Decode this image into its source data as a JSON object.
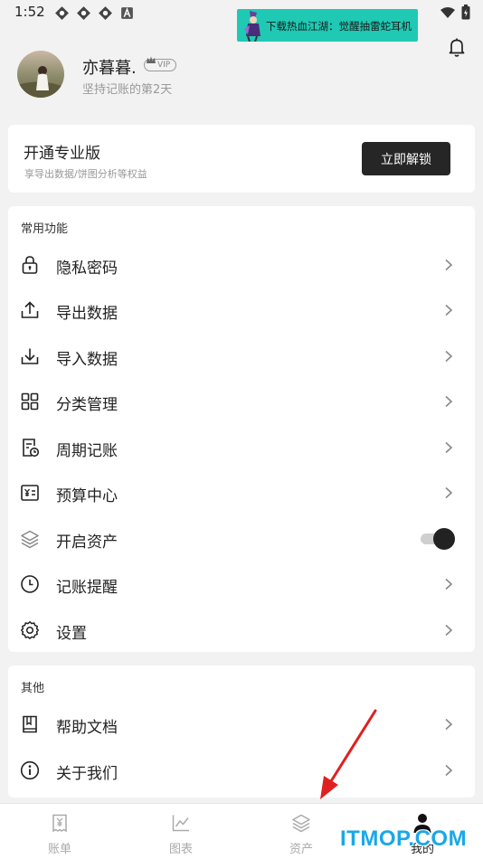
{
  "status_bar": {
    "time": "1:52"
  },
  "ad": {
    "text": "下载热血江湖：觉醒抽雷蛇耳机"
  },
  "profile": {
    "name": "亦暮暮.",
    "badge": "VIP",
    "subtitle": "坚持记账的第2天"
  },
  "pro_card": {
    "title": "开通专业版",
    "subtitle": "享导出数据/饼图分析等权益",
    "button": "立即解锁"
  },
  "common": {
    "title": "常用功能",
    "items": [
      {
        "label": "隐私密码",
        "icon": "lock-icon"
      },
      {
        "label": "导出数据",
        "icon": "upload-icon"
      },
      {
        "label": "导入数据",
        "icon": "download-icon"
      },
      {
        "label": "分类管理",
        "icon": "grid-icon"
      },
      {
        "label": "周期记账",
        "icon": "recurring-icon"
      },
      {
        "label": "预算中心",
        "icon": "budget-icon"
      },
      {
        "label": "开启资产",
        "icon": "layers-icon",
        "toggle_on": true
      },
      {
        "label": "记账提醒",
        "icon": "clock-icon"
      },
      {
        "label": "设置",
        "icon": "gear-icon"
      }
    ]
  },
  "other": {
    "title": "其他",
    "items": [
      {
        "label": "帮助文档",
        "icon": "book-icon"
      },
      {
        "label": "关于我们",
        "icon": "info-icon"
      }
    ]
  },
  "tabs": [
    {
      "label": "账单",
      "icon": "bill-icon",
      "active": false
    },
    {
      "label": "图表",
      "icon": "chart-icon",
      "active": false
    },
    {
      "label": "资产",
      "icon": "layers-icon",
      "active": false
    },
    {
      "label": "我的",
      "icon": "person-icon",
      "active": true
    }
  ],
  "watermark": "ITMOP.COM",
  "colors": {
    "toggle_knob": "#222222",
    "button_bg": "#262626",
    "ad_bg": "#1fc9b3",
    "watermark": "#1aa8e8",
    "arrow": "#e02020"
  }
}
